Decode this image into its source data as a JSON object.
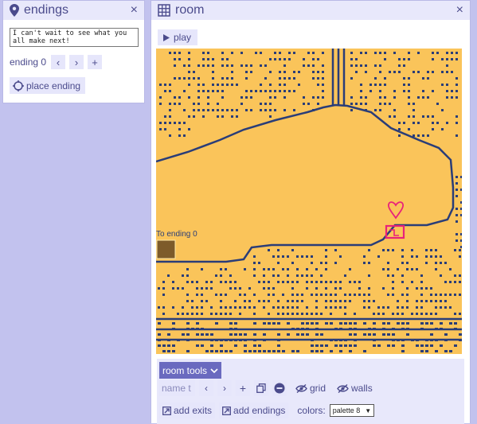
{
  "endings_panel": {
    "title": "endings",
    "close_label": "×",
    "ending_text": "I can't wait to see what you all make next!",
    "ending_label": "ending 0",
    "prev_label": "‹",
    "next_label": "›",
    "add_label": "+",
    "place_ending_label": "place ending",
    "icons": {
      "title_icon": "map-pin-icon",
      "place_icon": "target-icon"
    }
  },
  "room_panel": {
    "title": "room",
    "close_label": "×",
    "play_label": "play",
    "ending_marker_label": "To ending 0",
    "colors": {
      "background": "#fac45a",
      "tile": "#2a3d78",
      "sprite": "#e8227a",
      "marker": "#7d5b2a"
    },
    "tools": {
      "toggle_label": "room tools",
      "name_placeholder": "name t",
      "prev_label": "‹",
      "next_label": "›",
      "add_label": "+",
      "grid_label": "grid",
      "walls_label": "walls",
      "add_exits_label": "add exits",
      "add_endings_label": "add endings",
      "colors_label": "colors:",
      "palette_value": "palette 8",
      "icons": {
        "room_icon": "grid-icon",
        "play_icon": "play-icon",
        "duplicate_icon": "duplicate-icon",
        "delete_icon": "minus-circle-icon",
        "visibility_icon": "eye-slash-icon",
        "add_icon": "square-plus-icon"
      }
    }
  }
}
